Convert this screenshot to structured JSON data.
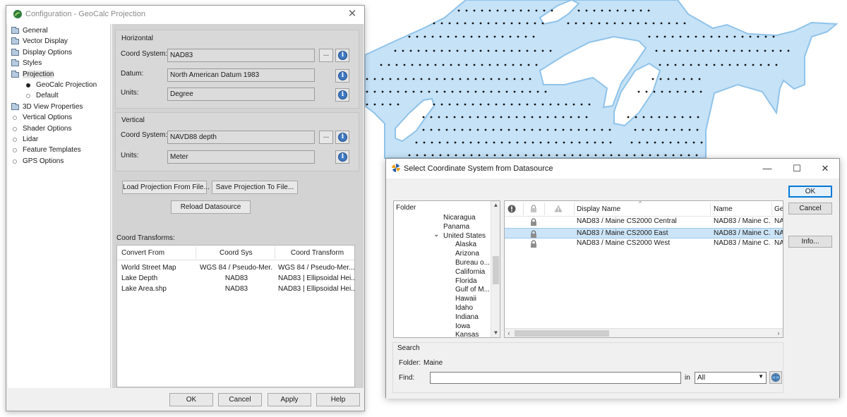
{
  "config_window": {
    "title": "Configuration - GeoCalc Projection",
    "tree": [
      {
        "label": "General",
        "icon": "folder-icon"
      },
      {
        "label": "Vector Display",
        "icon": "folder-icon"
      },
      {
        "label": "Display Options",
        "icon": "folder-icon"
      },
      {
        "label": "Styles",
        "icon": "folder-icon"
      },
      {
        "label": "Projection",
        "icon": "folder-open-icon",
        "selected": true
      },
      {
        "label": "GeoCalc Projection",
        "icon": "bullet-filled-icon",
        "child": true
      },
      {
        "label": "Default",
        "icon": "bullet-empty-icon",
        "child": true
      },
      {
        "label": "3D View Properties",
        "icon": "folder-icon"
      },
      {
        "label": "Vertical Options",
        "icon": "bullet-empty-icon"
      },
      {
        "label": "Shader Options",
        "icon": "bullet-empty-icon"
      },
      {
        "label": "Lidar",
        "icon": "bullet-empty-icon"
      },
      {
        "label": "Feature Templates",
        "icon": "bullet-empty-icon"
      },
      {
        "label": "GPS Options",
        "icon": "bullet-empty-icon"
      }
    ],
    "horizontal": {
      "title": "Horizontal",
      "coord_label": "Coord System:",
      "coord_value": "NAD83",
      "datum_label": "Datum:",
      "datum_value": "North American Datum 1983",
      "units_label": "Units:",
      "units_value": "Degree"
    },
    "vertical": {
      "title": "Vertical",
      "coord_label": "Coord System:",
      "coord_value": "NAVD88 depth",
      "units_label": "Units:",
      "units_value": "Meter"
    },
    "browse_label": "...",
    "info_glyph": "i",
    "load_button": "Load Projection From File...",
    "save_button": "Save Projection To File...",
    "reload_button": "Reload Datasource",
    "transforms": {
      "label": "Coord Transforms:",
      "columns": [
        "Convert From",
        "Coord Sys",
        "Coord Transform"
      ],
      "rows": [
        [
          "World Street Map",
          "WGS 84 / Pseudo-Mer...",
          "WGS 84 / Pseudo-Mer..."
        ],
        [
          "Lake Depth",
          "NAD83",
          "NAD83 | Ellipsoidal Hei..."
        ],
        [
          "Lake Area.shp",
          "NAD83",
          "NAD83 | Ellipsoidal Hei..."
        ]
      ]
    },
    "footer": {
      "ok": "OK",
      "cancel": "Cancel",
      "apply": "Apply",
      "help": "Help"
    }
  },
  "select_window": {
    "title": "Select Coordinate System from Datasource",
    "controls": {
      "minimize": "—",
      "maximize": "☐",
      "close": "✕"
    },
    "folder_header": "Folder",
    "folders": [
      {
        "label": "Nicaragua",
        "level": 0
      },
      {
        "label": "Panama",
        "level": 0
      },
      {
        "label": "United States",
        "level": 0,
        "expanded": true
      },
      {
        "label": "Alaska",
        "level": 1
      },
      {
        "label": "Arizona",
        "level": 1
      },
      {
        "label": "Bureau o...",
        "level": 1
      },
      {
        "label": "California",
        "level": 1
      },
      {
        "label": "Florida",
        "level": 1
      },
      {
        "label": "Gulf of M...",
        "level": 1
      },
      {
        "label": "Hawaii",
        "level": 1
      },
      {
        "label": "Idaho",
        "level": 1
      },
      {
        "label": "Indiana",
        "level": 1
      },
      {
        "label": "Iowa",
        "level": 1
      },
      {
        "label": "Kansas",
        "level": 1
      }
    ],
    "grid_columns": [
      "Display Name",
      "Name",
      "Ge"
    ],
    "grid_rows": [
      {
        "display": "NAD83 / Maine CS2000 Central",
        "name": "NAD83 / Maine C...",
        "ge": "NA"
      },
      {
        "display": "NAD83 / Maine CS2000 East",
        "name": "NAD83 / Maine C...",
        "ge": "NA",
        "selected": true
      },
      {
        "display": "NAD83 / Maine CS2000 West",
        "name": "NAD83 / Maine C...",
        "ge": "NA"
      }
    ],
    "search": {
      "title": "Search",
      "folder_label": "Folder:",
      "folder_value": "Maine",
      "find_label": "Find:",
      "find_value": "",
      "in_label": "in",
      "scope_value": "All"
    },
    "buttons": {
      "ok": "OK",
      "cancel": "Cancel",
      "info": "Info..."
    }
  },
  "colors": {
    "water": "#c6e2f7",
    "shore": "#8fc3ea",
    "selection": "#cce4f7",
    "accent": "#0078d7"
  }
}
